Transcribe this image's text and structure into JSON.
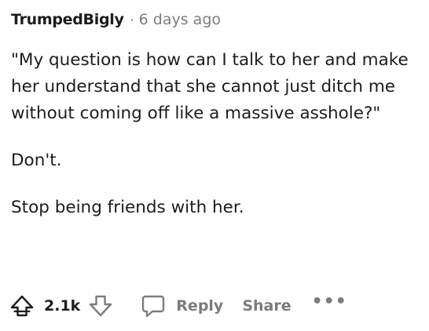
{
  "comment": {
    "author": "TrumpedBigly",
    "separator": "·",
    "timestamp": "6 days ago",
    "paragraphs": [
      "\"My question is how can I talk to her and make her understand that she cannot just ditch me without coming off like a massive asshole?\"",
      "Don't.",
      "Stop being friends with her."
    ]
  },
  "actions": {
    "upvote_icon": "upvote-icon",
    "score": "2.1k",
    "downvote_icon": "downvote-icon",
    "reply_icon": "speech-bubble-icon",
    "reply_label": "Reply",
    "share_label": "Share",
    "more_label": "•••"
  },
  "colors": {
    "text": "#1c1c1c",
    "muted": "#7c7c7c",
    "background": "#ffffff"
  }
}
